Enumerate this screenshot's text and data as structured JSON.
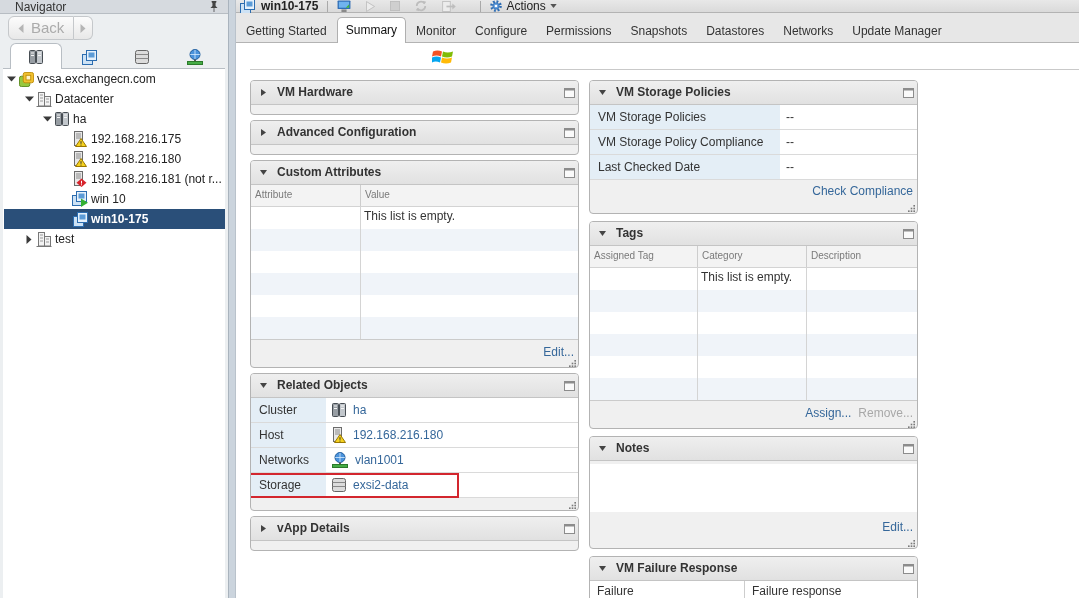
{
  "navigator": {
    "title": "Navigator",
    "back_button": {
      "label": "Back",
      "disabled": true
    },
    "forward_button": {
      "disabled": true
    },
    "tabs": [
      {
        "kind": "hosts",
        "selected": true
      },
      {
        "kind": "vms",
        "selected": false
      },
      {
        "kind": "storage",
        "selected": false
      },
      {
        "kind": "network",
        "selected": false
      }
    ],
    "tree": [
      {
        "label": "vcsa.exchangecn.com",
        "kind": "vcenter",
        "expanded": true,
        "selected": false,
        "children": [
          {
            "label": "Datacenter",
            "kind": "datacenter",
            "expanded": true,
            "selected": false,
            "children": [
              {
                "label": "ha",
                "kind": "cluster",
                "expanded": true,
                "selected": false,
                "children": [
                  {
                    "label": "192.168.216.175",
                    "kind": "host_warning",
                    "selected": false
                  },
                  {
                    "label": "192.168.216.180",
                    "kind": "host_warning",
                    "selected": false
                  },
                  {
                    "label": "192.168.216.181 (not r...",
                    "kind": "host_error",
                    "selected": false
                  },
                  {
                    "label": "win 10",
                    "kind": "vm_running",
                    "selected": false
                  },
                  {
                    "label": "win10-175",
                    "kind": "vm",
                    "selected": true
                  }
                ]
              }
            ]
          },
          {
            "label": "test",
            "kind": "datacenter",
            "expanded": false,
            "selected": false
          }
        ]
      }
    ]
  },
  "object": {
    "title": "win10-175",
    "toolbar": [
      {
        "kind": "console",
        "disabled": false
      },
      {
        "kind": "power_on",
        "disabled": true
      },
      {
        "kind": "power_off",
        "disabled": true
      },
      {
        "kind": "suspend",
        "disabled": true
      },
      {
        "kind": "migrate",
        "disabled": true
      }
    ],
    "actions_menu": {
      "label": "Actions"
    }
  },
  "tabs": [
    {
      "label": "Getting Started",
      "selected": false
    },
    {
      "label": "Summary",
      "selected": true
    },
    {
      "label": "Monitor",
      "selected": false
    },
    {
      "label": "Configure",
      "selected": false
    },
    {
      "label": "Permissions",
      "selected": false
    },
    {
      "label": "Snapshots",
      "selected": false
    },
    {
      "label": "Datastores",
      "selected": false
    },
    {
      "label": "Networks",
      "selected": false
    },
    {
      "label": "Update Manager",
      "selected": false
    }
  ],
  "portlets": {
    "left": [
      {
        "title": "VM Hardware",
        "expanded": false
      },
      {
        "title": "Advanced Configuration",
        "expanded": false
      },
      {
        "title": "Custom Attributes",
        "expanded": true,
        "kind": "table",
        "columns": [
          "Attribute",
          "Value"
        ],
        "empty_message": "This list is empty.",
        "actions": [
          {
            "label": "Edit...",
            "disabled": false
          }
        ]
      },
      {
        "title": "Related Objects",
        "expanded": true,
        "kind": "properties",
        "rows": [
          {
            "label": "Cluster",
            "value": "ha",
            "kind": "cluster",
            "highlighted": false
          },
          {
            "label": "Host",
            "value": "192.168.216.180",
            "kind": "host_warning",
            "highlighted": false
          },
          {
            "label": "Networks",
            "value": "vlan1001",
            "kind": "network",
            "highlighted": false
          },
          {
            "label": "Storage",
            "value": "exsi2-data",
            "kind": "datastore",
            "highlighted": true
          }
        ]
      },
      {
        "title": "vApp Details",
        "expanded": false
      }
    ],
    "right": [
      {
        "title": "VM Storage Policies",
        "expanded": true,
        "kind": "properties",
        "rows": [
          {
            "label": "VM Storage Policies",
            "value": "--"
          },
          {
            "label": "VM Storage Policy Compliance",
            "value": "--"
          },
          {
            "label": "Last Checked Date",
            "value": "--"
          }
        ],
        "actions": [
          {
            "label": "Check Compliance",
            "disabled": false
          }
        ]
      },
      {
        "title": "Tags",
        "expanded": true,
        "kind": "table",
        "columns": [
          "Assigned Tag",
          "Category",
          "Description"
        ],
        "empty_message": "This list is empty.",
        "actions": [
          {
            "label": "Assign...",
            "disabled": false
          },
          {
            "label": "Remove...",
            "disabled": true
          }
        ]
      },
      {
        "title": "Notes",
        "expanded": true,
        "kind": "notes",
        "actions": [
          {
            "label": "Edit...",
            "disabled": false
          }
        ]
      },
      {
        "title": "VM Failure Response",
        "expanded": true,
        "kind": "grid",
        "columns": [
          "Failure",
          "Failure response"
        ]
      }
    ]
  }
}
